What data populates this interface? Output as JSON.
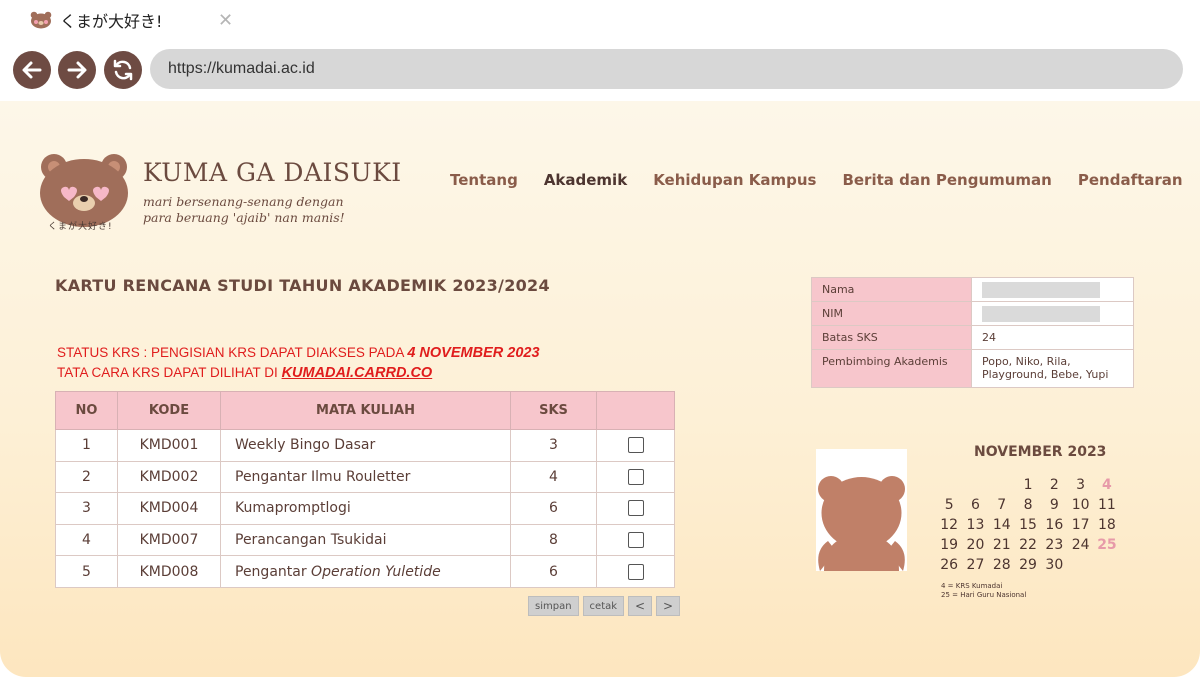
{
  "browser": {
    "tab_title": "くまが大好き!",
    "url": "https://kumadai.ac.id"
  },
  "site": {
    "brand": "KUMA GA DAISUKI",
    "tagline_line1": "mari bersenang-senang dengan",
    "tagline_line2": "para beruang 'ajaib' nan manis!",
    "logo_text": "くまが大好き!"
  },
  "nav": {
    "items": [
      {
        "label": "Tentang",
        "active": false
      },
      {
        "label": "Akademik",
        "active": true
      },
      {
        "label": "Kehidupan Kampus",
        "active": false
      },
      {
        "label": "Berita dan Pengumuman",
        "active": false
      },
      {
        "label": "Pendaftaran",
        "active": false
      }
    ]
  },
  "krs": {
    "title": "KARTU RENCANA STUDI TAHUN AKADEMIK 2023/2024",
    "status_prefix": "STATUS KRS : PENGISIAN KRS DAPAT DIAKSES PADA ",
    "status_date": "4 NOVEMBER 2023",
    "guide_prefix": "TATA CARA KRS DAPAT DILIHAT DI ",
    "guide_link": "KUMADAI.CARRD.CO",
    "columns": {
      "no": "NO",
      "kode": "KODE",
      "mata_kuliah": "MATA KULIAH",
      "sks": "SKS",
      "select": ""
    },
    "rows": [
      {
        "no": "1",
        "kode": "KMD001",
        "mata_kuliah": "Weekly Bingo Dasar",
        "sks": "3"
      },
      {
        "no": "2",
        "kode": "KMD002",
        "mata_kuliah": "Pengantar Ilmu Rouletter",
        "sks": "4"
      },
      {
        "no": "3",
        "kode": "KMD004",
        "mata_kuliah": "Kumapromptlogi",
        "sks": "6"
      },
      {
        "no": "4",
        "kode": "KMD007",
        "mata_kuliah": "Perancangan Tsukidai",
        "sks": "8"
      },
      {
        "no": "5",
        "kode": "KMD008",
        "mata_kuliah_prefix": "Pengantar ",
        "mata_kuliah_italic": "Operation Yuletide",
        "sks": "6"
      }
    ],
    "buttons": {
      "save": "simpan",
      "print": "cetak",
      "prev": "<",
      "next": ">"
    }
  },
  "student": {
    "rows": [
      {
        "label": "Nama",
        "value": ""
      },
      {
        "label": "NIM",
        "value": ""
      },
      {
        "label": "Batas SKS",
        "value": "24"
      },
      {
        "label": "Pembimbing Akademis",
        "value_line1": "Popo, Niko, Rila,",
        "value_line2": "Playground, Bebe, Yupi"
      }
    ]
  },
  "calendar": {
    "title": "NOVEMBER 2023",
    "weeks": [
      [
        "",
        "",
        "",
        "1",
        "2",
        "3",
        "4"
      ],
      [
        "5",
        "6",
        "7",
        "8",
        "9",
        "10",
        "11"
      ],
      [
        "12",
        "13",
        "14",
        "15",
        "16",
        "17",
        "18"
      ],
      [
        "19",
        "20",
        "21",
        "22",
        "23",
        "24",
        "25"
      ],
      [
        "26",
        "27",
        "28",
        "29",
        "30",
        "",
        ""
      ]
    ],
    "highlighted_days": [
      "4",
      "25"
    ],
    "highlight_color": "#e79aa9",
    "note_line1": "4 = KRS Kumadai",
    "note_line2": "25 = Hari Guru Nasional"
  },
  "colors": {
    "accent_brown": "#6e4b43",
    "header_pink": "#f7c6cc",
    "status_red": "#e01d1d"
  }
}
